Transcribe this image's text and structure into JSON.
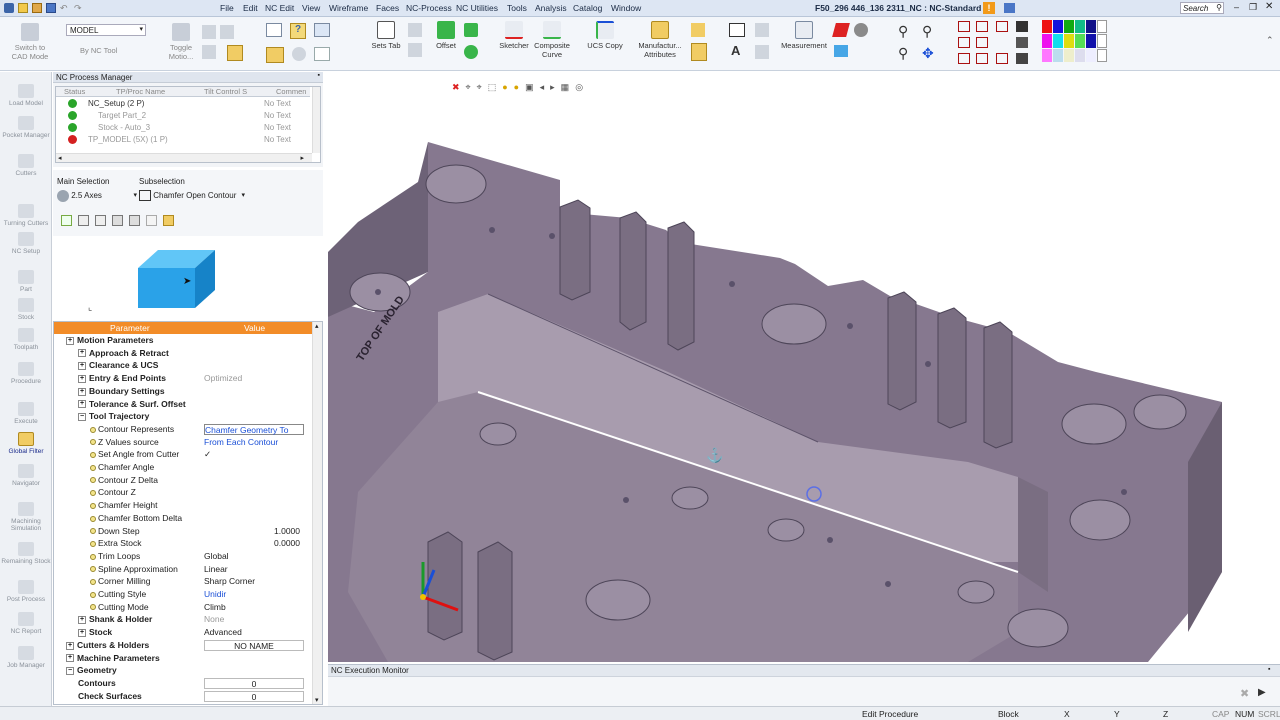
{
  "title_bar": {
    "menus": [
      "File",
      "Edit",
      "NC Edit",
      "View",
      "Wireframe",
      "Faces",
      "NC-Process",
      "NC Utilities",
      "Tools",
      "Analysis",
      "Catalog",
      "Window"
    ],
    "document_title": "F50_296 446_136 2311_NC : NC-Standard",
    "search_label": "Search"
  },
  "ribbon": {
    "switch_label": "Switch to CAD Mode",
    "model_dropdown": "MODEL",
    "by_nc_tool": "By NC Tool",
    "toggle_motion": "Toggle Motio...",
    "sets_tab": "Sets Tab",
    "offset": "Offset",
    "sketcher": "Sketcher",
    "composite_curve": "Composite Curve",
    "ucs_copy": "UCS Copy",
    "manufacturing_attributes": "Manufactur... Attributes",
    "measurement": "Measurement"
  },
  "left_toolbar": {
    "items": [
      "Load Model",
      "Pocket Manager",
      "Cutters",
      "Turning Cutters",
      "NC Setup",
      "Part",
      "Stock",
      "Toolpath",
      "Procedure",
      "Execute",
      "Global Filter",
      "Navigator",
      "Machining Simulation",
      "Remaining Stock",
      "Post Process",
      "NC Report",
      "Job Manager"
    ]
  },
  "process_manager": {
    "title": "NC Process Manager",
    "columns": [
      "Status",
      "TP/Proc Name",
      "Tilt Control S",
      "Commen"
    ],
    "rows": [
      {
        "status": "ok",
        "name": "NC_Setup (2 P)",
        "comment": "No Text"
      },
      {
        "status": "ok",
        "name": "Target Part_2",
        "comment": "No Text"
      },
      {
        "status": "ok",
        "name": "Stock - Auto_3",
        "comment": "No Text"
      },
      {
        "status": "error",
        "name": "TP_MODEL (5X) (1 P)",
        "comment": "No Text"
      }
    ]
  },
  "selection": {
    "main_label": "Main Selection",
    "main_value": "2.5 Axes",
    "sub_label": "Subselection",
    "sub_value": "Chamfer Open Contour"
  },
  "param_table": {
    "header_parameter": "Parameter",
    "header_value": "Value",
    "rows": [
      {
        "name": "Motion Parameters",
        "value": "",
        "level": 0,
        "type": "group",
        "bold": true
      },
      {
        "name": "Approach & Retract",
        "value": "",
        "level": 1,
        "type": "group",
        "bold": true
      },
      {
        "name": "Clearance & UCS",
        "value": "",
        "level": 1,
        "type": "group",
        "bold": true
      },
      {
        "name": "Entry & End Points",
        "value": "Optimized",
        "level": 1,
        "type": "group",
        "bold": true,
        "vstyle": "grey"
      },
      {
        "name": "Boundary Settings",
        "value": "",
        "level": 1,
        "type": "group",
        "bold": true
      },
      {
        "name": "Tolerance & Surf. Offset",
        "value": "",
        "level": 1,
        "type": "group",
        "bold": true
      },
      {
        "name": "Tool Trajectory",
        "value": "",
        "level": 1,
        "type": "group",
        "bold": true,
        "open": true
      },
      {
        "name": "Contour Represents",
        "value": "Chamfer Geometry To",
        "level": 2,
        "type": "param",
        "vstyle": "blue"
      },
      {
        "name": "Z Values source",
        "value": "From Each Contour",
        "level": 2,
        "type": "param",
        "vstyle": "blue"
      },
      {
        "name": "Set Angle from Cutter",
        "value": "✓",
        "level": 2,
        "type": "param"
      },
      {
        "name": "Chamfer Angle",
        "value": "",
        "level": 2,
        "type": "param"
      },
      {
        "name": "Contour Z Delta",
        "value": "",
        "level": 2,
        "type": "param"
      },
      {
        "name": "Contour Z",
        "value": "",
        "level": 2,
        "type": "param"
      },
      {
        "name": "Chamfer Height",
        "value": "",
        "level": 2,
        "type": "param"
      },
      {
        "name": "Chamfer Bottom Delta",
        "value": "",
        "level": 2,
        "type": "param"
      },
      {
        "name": "Down Step",
        "value": "1.0000",
        "level": 2,
        "type": "param",
        "vstyle": "right"
      },
      {
        "name": "Extra Stock",
        "value": "0.0000",
        "level": 2,
        "type": "param",
        "vstyle": "right"
      },
      {
        "name": "Trim Loops",
        "value": "Global",
        "level": 2,
        "type": "param"
      },
      {
        "name": "Spline Approximation",
        "value": "Linear",
        "level": 2,
        "type": "param"
      },
      {
        "name": "Corner Milling",
        "value": "Sharp Corner",
        "level": 2,
        "type": "param"
      },
      {
        "name": "Cutting Style",
        "value": "Unidir",
        "level": 2,
        "type": "param",
        "vstyle": "blue"
      },
      {
        "name": "Cutting Mode",
        "value": "Climb",
        "level": 2,
        "type": "param"
      },
      {
        "name": "Shank & Holder",
        "value": "None",
        "level": 1,
        "type": "group",
        "bold": true,
        "vstyle": "grey"
      },
      {
        "name": "Stock",
        "value": "Advanced",
        "level": 1,
        "type": "group",
        "bold": true
      },
      {
        "name": "Cutters & Holders",
        "value": "NO NAME",
        "level": 0,
        "type": "group",
        "bold": true,
        "vstyle": "box"
      },
      {
        "name": "Machine Parameters",
        "value": "",
        "level": 0,
        "type": "group",
        "bold": true
      },
      {
        "name": "Geometry",
        "value": "",
        "level": 0,
        "type": "group",
        "bold": true,
        "open": true
      },
      {
        "name": "Contours",
        "value": "0",
        "level": 1,
        "type": "leaf",
        "bold": true,
        "vstyle": "box"
      },
      {
        "name": "Check Surfaces",
        "value": "0",
        "level": 1,
        "type": "leaf",
        "bold": true,
        "vstyle": "box"
      }
    ]
  },
  "viewport": {
    "engraving": "TOP OF MOLD"
  },
  "execution_monitor": {
    "title": "NC Execution Monitor"
  },
  "status_bar": {
    "edit_procedure": "Edit Procedure",
    "block": "Block",
    "x": "X",
    "y": "Y",
    "z": "Z",
    "cap": "CAP",
    "num": "NUM",
    "scrl": "SCRL"
  }
}
